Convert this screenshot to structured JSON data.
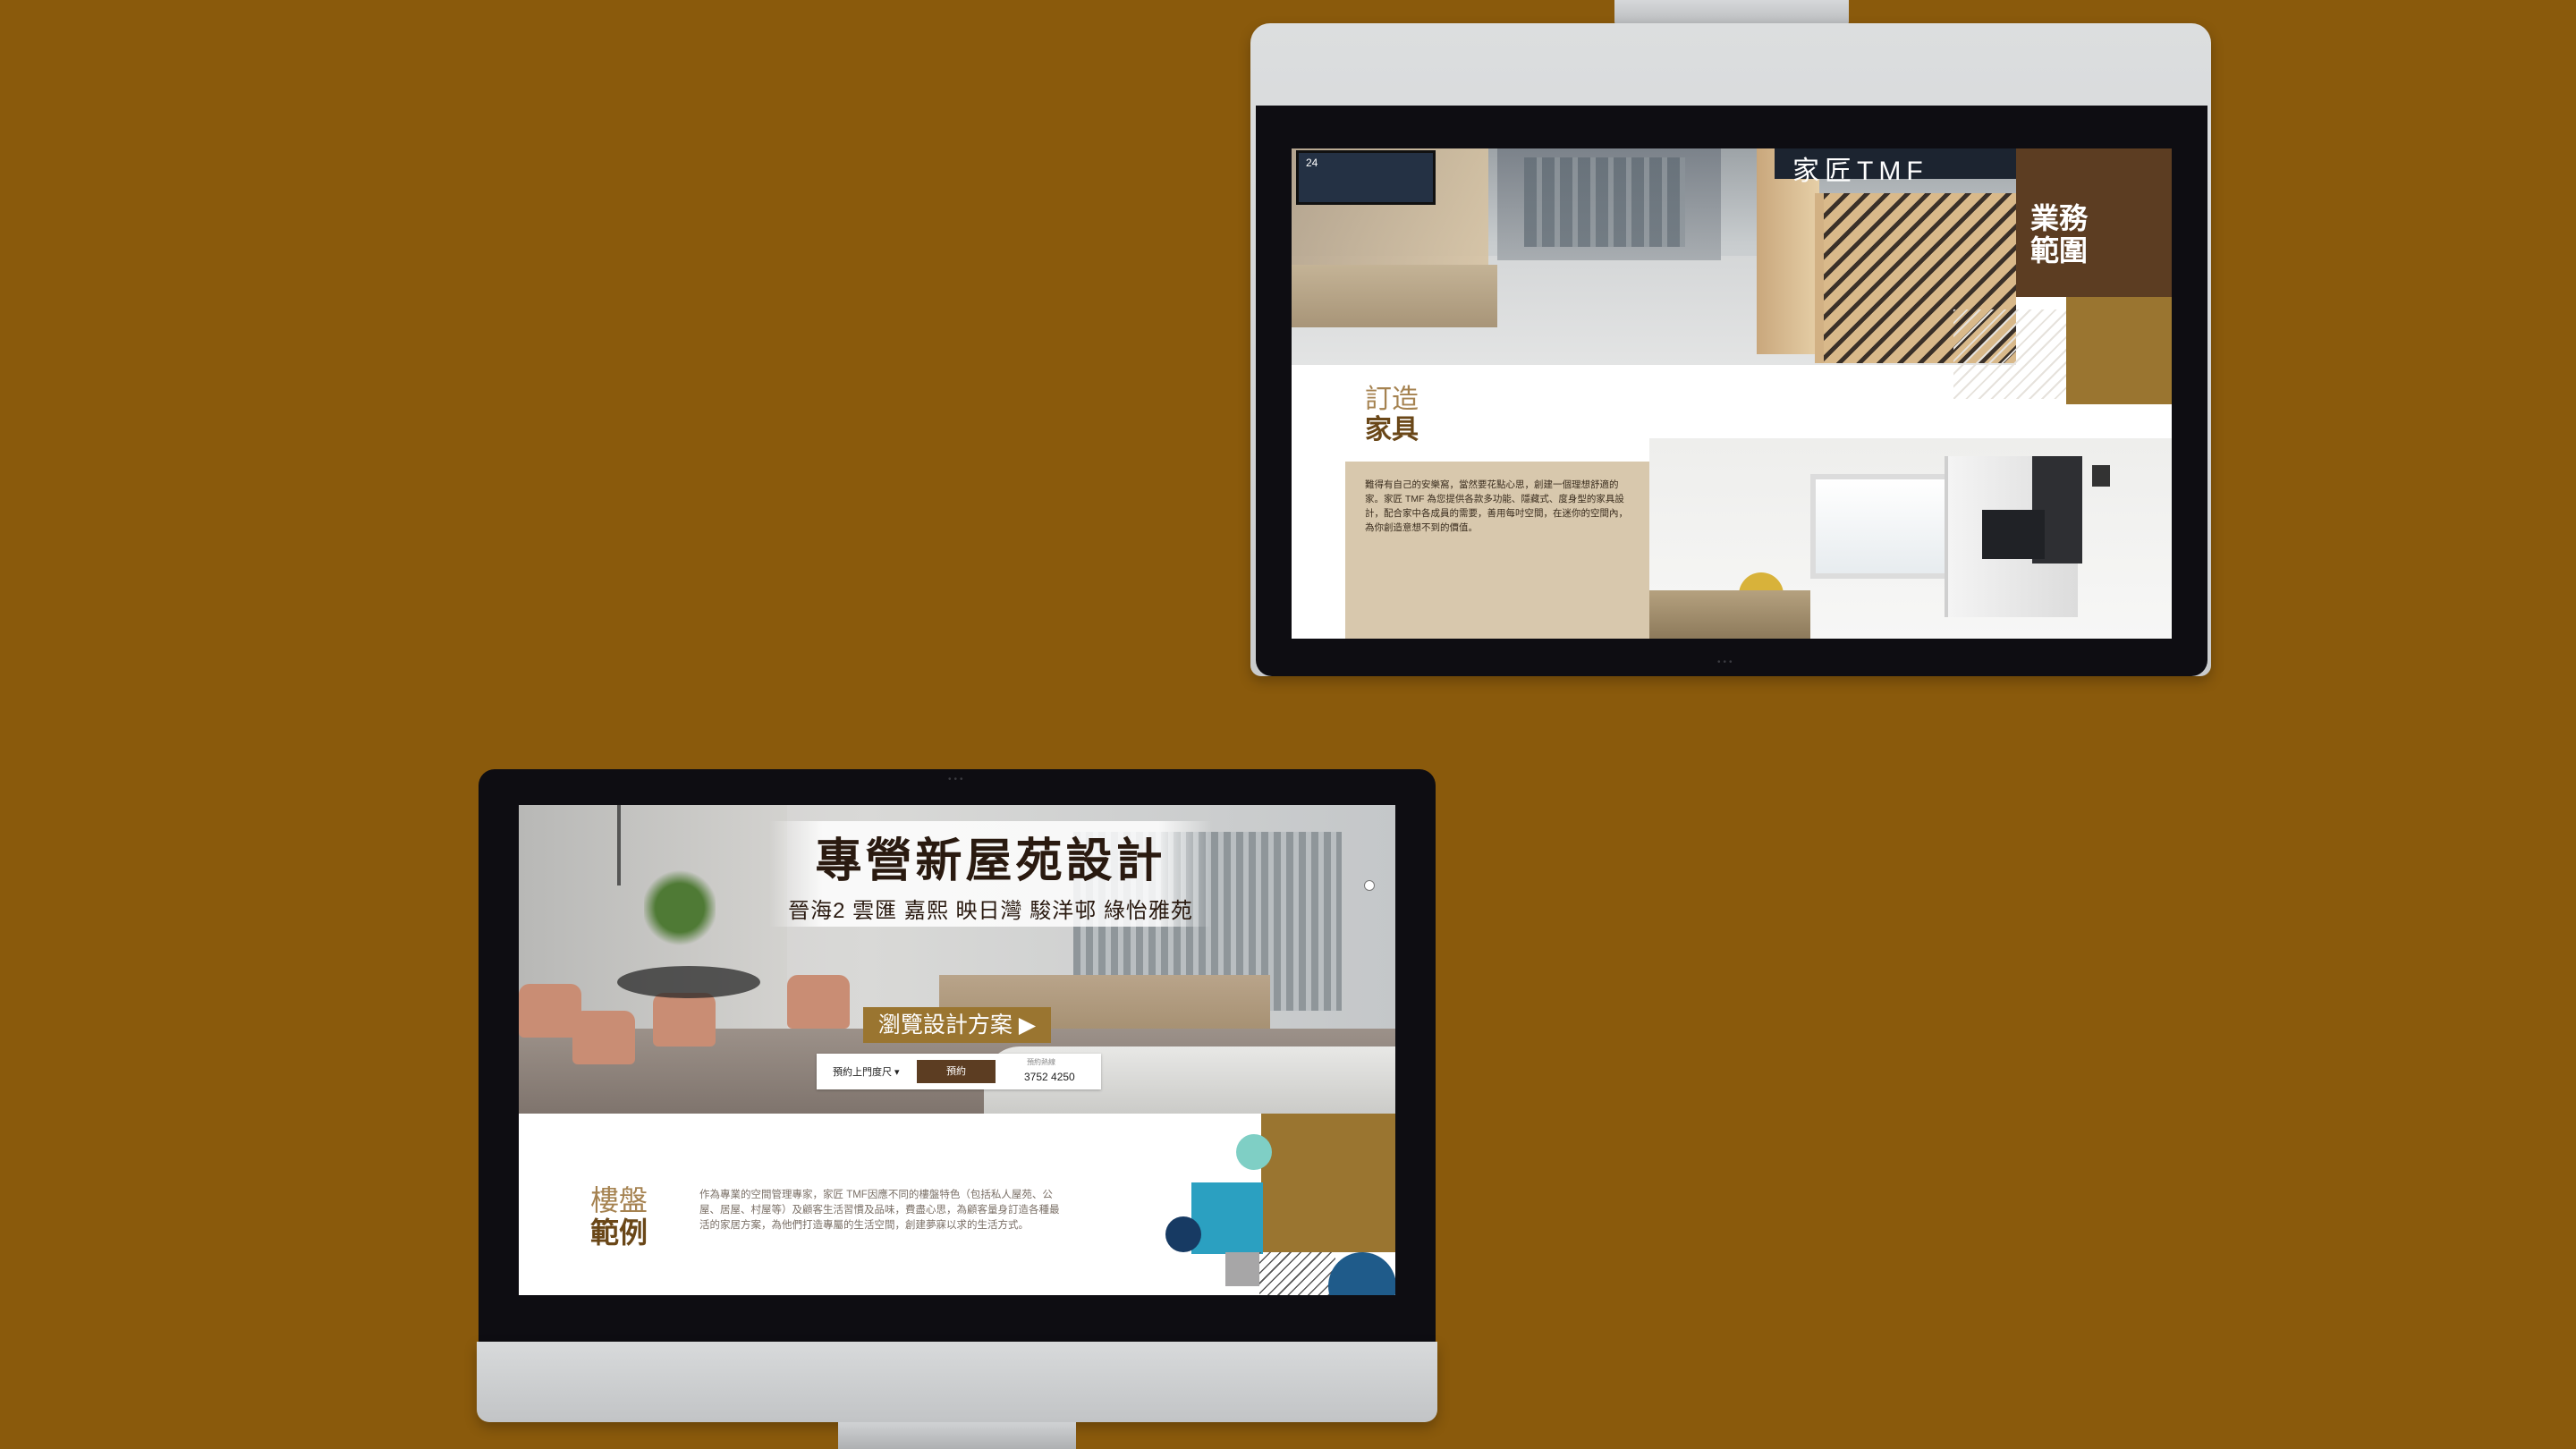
{
  "background_color": "#8a5a0c",
  "top_monitor": {
    "store_screen_text": "24",
    "store_sign_text": "家匠TMF",
    "section_label": "業務範圍",
    "section_line1": "業務",
    "section_line2": "範圍",
    "furniture": {
      "title_line1": "訂造",
      "title_line2": "家具",
      "body": "難得有自己的安樂窩，當然要花點心思，創建一個理想舒適的家。家匠 TMF 為您提供各款多功能、隱藏式、度身型的家具設計，配合家中各成員的需要，善用每吋空間，在迷你的空間內，為你創造意想不到的價值。"
    },
    "colors": {
      "brown": "#5c3d22",
      "gold": "#9a7530",
      "beige": "#d8c8ad"
    }
  },
  "bottom_monitor": {
    "hero": {
      "title": "專營新屋苑設計",
      "subtitle": "晉海2  雲匯  嘉熙  映日灣  駿洋邨  綠怡雅苑",
      "browse_button": "瀏覽設計方案 ▶"
    },
    "booking": {
      "select_label": "預約上門度尺 ▾",
      "button_label": "預約",
      "phone_label": "預約熱線",
      "phone": "3752 4250"
    },
    "properties": {
      "title_line1": "樓盤",
      "title_line2": "範例",
      "body": "作為專業的空間管理專家，家匠 TMF因應不同的樓盤特色（包括私人屋苑、公屋、居屋、村屋等）及顧客生活習慣及品味，費盡心思，為顧客量身訂造各種最活的家居方案，為他們打造專屬的生活空間，創建夢寐以求的生活方式。"
    },
    "colors": {
      "gold": "#9a7530",
      "mint": "#7fcfc5",
      "teal": "#2ba0c1",
      "navy": "#173a63",
      "grey": "#a7a6a7",
      "blue": "#1f5b8a"
    }
  }
}
